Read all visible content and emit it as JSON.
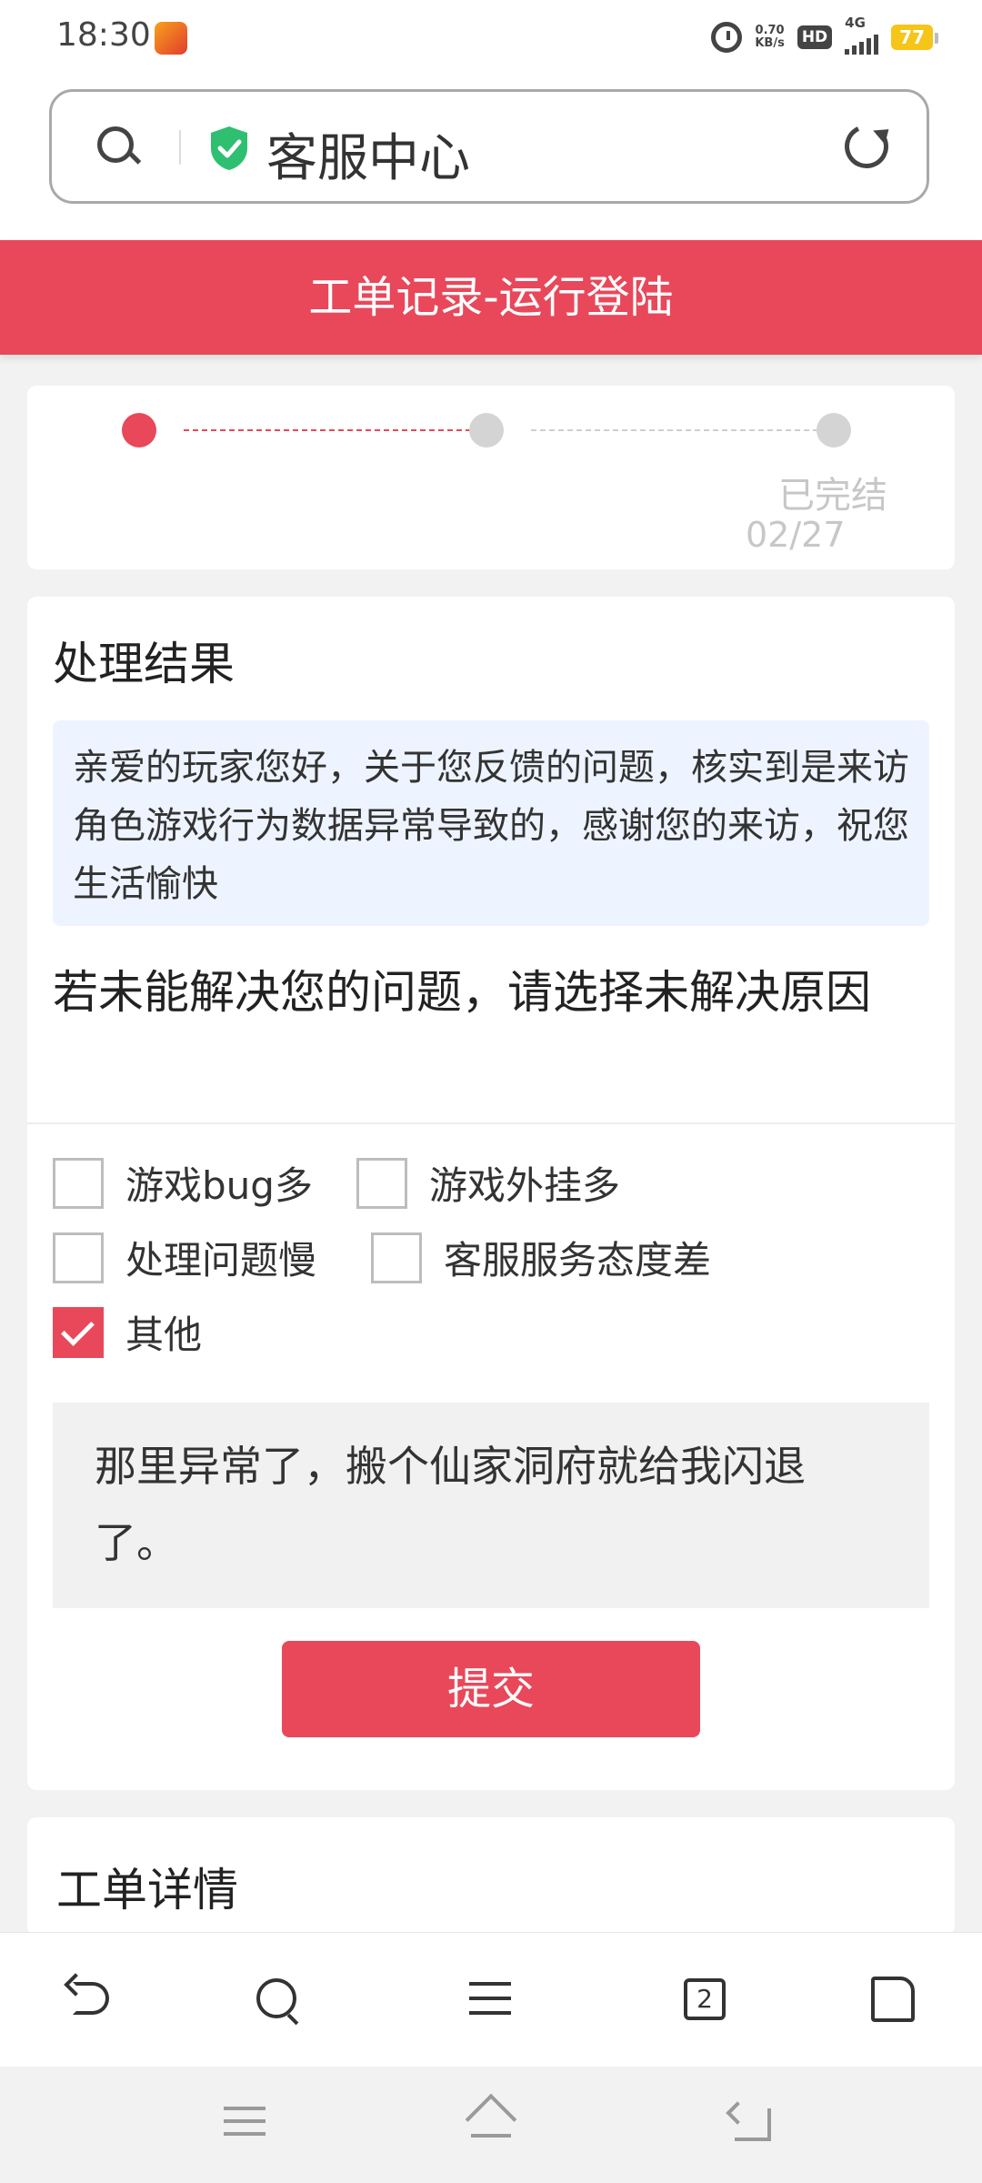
{
  "status_bar": {
    "time": "18:30",
    "net_speed_value": "0.70",
    "net_speed_unit": "KB/s",
    "hd_label": "HD",
    "network_label": "4G",
    "battery": "77"
  },
  "address_bar": {
    "title": "客服中心"
  },
  "header": {
    "title": "工单记录-运行登陆"
  },
  "progress": {
    "step_label": "已完结",
    "step_date": "02/27"
  },
  "result": {
    "title": "处理结果",
    "message": "亲爱的玩家您好，关于您反馈的问题，核实到是来访角色游戏行为数据异常导致的，感谢您的来访，祝您生活愉快",
    "question": "若未能解决您的问题，请选择未解决原因",
    "options": [
      {
        "label": "游戏bug多",
        "checked": false
      },
      {
        "label": "游戏外挂多",
        "checked": false
      },
      {
        "label": "处理问题慢",
        "checked": false
      },
      {
        "label": "客服服务态度差",
        "checked": false
      },
      {
        "label": "其他",
        "checked": true
      }
    ],
    "other_text": "那里异常了，搬个仙家洞府就给我闪退了。",
    "submit_label": "提交"
  },
  "details": {
    "title": "工单详情"
  },
  "browser_toolbar": {
    "tab_count": "2"
  },
  "colors": {
    "accent": "#e8485a",
    "message_bg": "#eef4ff"
  }
}
